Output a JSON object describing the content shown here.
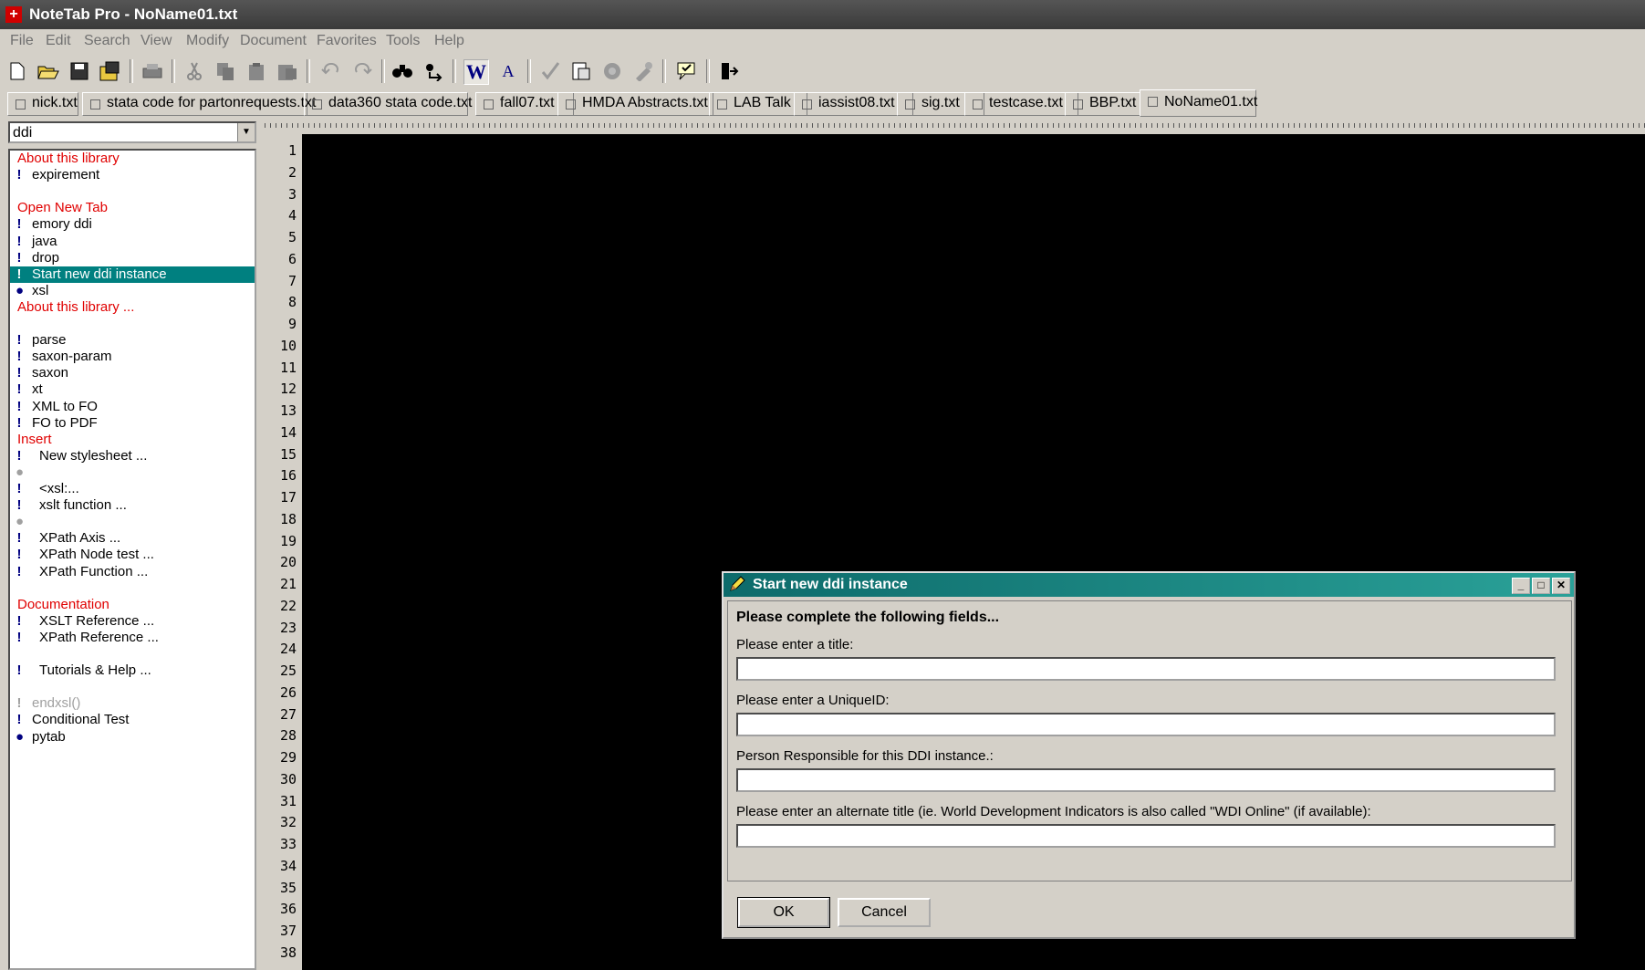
{
  "window": {
    "title": "NoteTab Pro  -  NoName01.txt"
  },
  "menu": [
    "File",
    "Edit",
    "Search",
    "View",
    "Modify",
    "Document",
    "Favorites",
    "Tools",
    "Help"
  ],
  "toolbar": {
    "icons": [
      "new-file-icon",
      "open-file-icon",
      "save-icon",
      "save-all-icon",
      "print-icon",
      "cut-icon",
      "copy-icon",
      "paste-icon",
      "paste-special-icon",
      "undo-icon",
      "redo-icon",
      "find-icon",
      "replace-icon",
      "word-wrap-icon",
      "font-icon",
      "spell-check-icon",
      "clipbook-icon",
      "stats-icon",
      "tools-icon",
      "library-icon",
      "exit-icon"
    ]
  },
  "tabs": [
    "nick.txt",
    "stata code for partonrequests.txt",
    "data360 stata code.txt",
    "fall07.txt",
    "HMDA Abstracts.txt",
    "LAB Talk",
    "iassist08.txt",
    "sig.txt",
    "testcase.txt",
    "BBP.txt",
    "NoName01.txt"
  ],
  "library": {
    "selected": "ddi",
    "items": [
      {
        "text": "About this library",
        "kind": "head"
      },
      {
        "text": "expirement",
        "kind": "clip",
        "marker": "!"
      },
      {
        "text": "",
        "kind": "blank"
      },
      {
        "text": "Open New Tab",
        "kind": "head"
      },
      {
        "text": "emory ddi",
        "kind": "clip",
        "marker": "!"
      },
      {
        "text": "java",
        "kind": "clip",
        "marker": "!"
      },
      {
        "text": "drop",
        "kind": "clip",
        "marker": "!"
      },
      {
        "text": "Start new ddi instance",
        "kind": "sel",
        "marker": "!"
      },
      {
        "text": "xsl",
        "kind": "clip",
        "marker": "●"
      },
      {
        "text": "About this library ...",
        "kind": "head"
      },
      {
        "text": "",
        "kind": "blank"
      },
      {
        "text": "parse",
        "kind": "clip",
        "marker": "!"
      },
      {
        "text": "saxon-param",
        "kind": "clip",
        "marker": "!"
      },
      {
        "text": "saxon",
        "kind": "clip",
        "marker": "!"
      },
      {
        "text": "xt",
        "kind": "clip",
        "marker": "!"
      },
      {
        "text": "XML to FO",
        "kind": "clip",
        "marker": "!"
      },
      {
        "text": "FO to PDF",
        "kind": "clip",
        "marker": "!"
      },
      {
        "text": "Insert",
        "kind": "head"
      },
      {
        "text": "New stylesheet ...",
        "kind": "ind",
        "marker": "!"
      },
      {
        "text": "",
        "kind": "dim",
        "marker": "●"
      },
      {
        "text": "<xsl:...",
        "kind": "ind",
        "marker": "!"
      },
      {
        "text": "xslt function ...",
        "kind": "ind",
        "marker": "!"
      },
      {
        "text": "",
        "kind": "dim",
        "marker": "●"
      },
      {
        "text": "XPath Axis ...",
        "kind": "ind",
        "marker": "!"
      },
      {
        "text": "XPath Node test ...",
        "kind": "ind",
        "marker": "!"
      },
      {
        "text": "XPath Function ...",
        "kind": "ind",
        "marker": "!"
      },
      {
        "text": "",
        "kind": "blank"
      },
      {
        "text": "Documentation",
        "kind": "head"
      },
      {
        "text": "XSLT Reference ...",
        "kind": "ind",
        "marker": "!"
      },
      {
        "text": "XPath Reference ...",
        "kind": "ind",
        "marker": "!"
      },
      {
        "text": "",
        "kind": "blank"
      },
      {
        "text": "Tutorials & Help ...",
        "kind": "ind",
        "marker": "!"
      },
      {
        "text": "",
        "kind": "blank"
      },
      {
        "text": "endxsl()",
        "kind": "dim",
        "marker": "!"
      },
      {
        "text": "Conditional Test",
        "kind": "clip",
        "marker": "!"
      },
      {
        "text": "pytab",
        "kind": "clip",
        "marker": "●"
      }
    ]
  },
  "line_numbers": [
    "1",
    "2",
    "3",
    "4",
    "5",
    "6",
    "7",
    "8",
    "9",
    "10",
    "11",
    "12",
    "13",
    "14",
    "15",
    "16",
    "17",
    "18",
    "19",
    "20",
    "21",
    "22",
    "23",
    "24",
    "25",
    "26",
    "27",
    "28",
    "29",
    "30",
    "31",
    "32",
    "33",
    "34",
    "35",
    "36",
    "37",
    "38"
  ],
  "dialog": {
    "title": "Start new ddi instance",
    "heading": "Please complete the following fields...",
    "fields": [
      {
        "label": "Please enter a title:",
        "value": ""
      },
      {
        "label": "Please enter a UniqueID:",
        "value": ""
      },
      {
        "label": "Person Responsible for this DDI instance.:",
        "value": ""
      },
      {
        "label": "Please enter an alternate title (ie. World Development Indicators is also called \"WDI Online\" (if available):",
        "value": ""
      }
    ],
    "ok_label": "OK",
    "cancel_label": "Cancel",
    "minimize_glyph": "_",
    "maximize_glyph": "□",
    "close_glyph": "✕"
  }
}
